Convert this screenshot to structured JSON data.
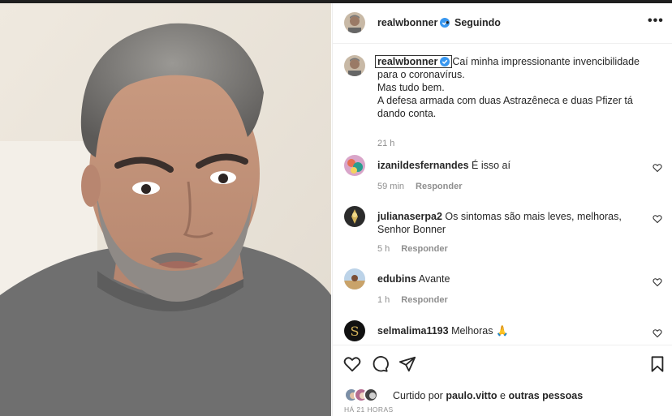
{
  "header": {
    "username": "realwbonner",
    "separator": "•",
    "follow_label": "Seguindo",
    "more_label": "•••"
  },
  "caption": {
    "username": "realwbonner",
    "lines": [
      "Caí minha impressionante invencibilidade para o coronavírus.",
      "Mas tudo bem.",
      "A defesa armada com duas Astrazêneca e duas Pfizer tá dando conta."
    ],
    "time": "21 h"
  },
  "comments": [
    {
      "user": "izanildesfernandes",
      "text": "É isso aí",
      "time": "59 min",
      "reply": "Responder"
    },
    {
      "user": "julianaserpa2",
      "text": "Os sintomas são mais leves, melhoras, Senhor Bonner",
      "time": "5 h",
      "reply": "Responder"
    },
    {
      "user": "edubins",
      "text": "Avante",
      "time": "1 h",
      "reply": "Responder"
    },
    {
      "user": "selmalima1193",
      "text": "Melhoras",
      "emoji": "🙏"
    }
  ],
  "likes": {
    "prefix": "Curtido por",
    "user": "paulo.vitto",
    "connector": "e",
    "others": "outras pessoas"
  },
  "posted": "HÁ 21 HORAS",
  "icons": [
    "heart-icon",
    "comment-icon",
    "share-icon",
    "bookmark-icon",
    "verified-icon",
    "more-options-icon"
  ],
  "colors": {
    "verified": "#3897f0",
    "muted": "#8e8e8e",
    "text": "#262626",
    "divider": "#efefef"
  }
}
